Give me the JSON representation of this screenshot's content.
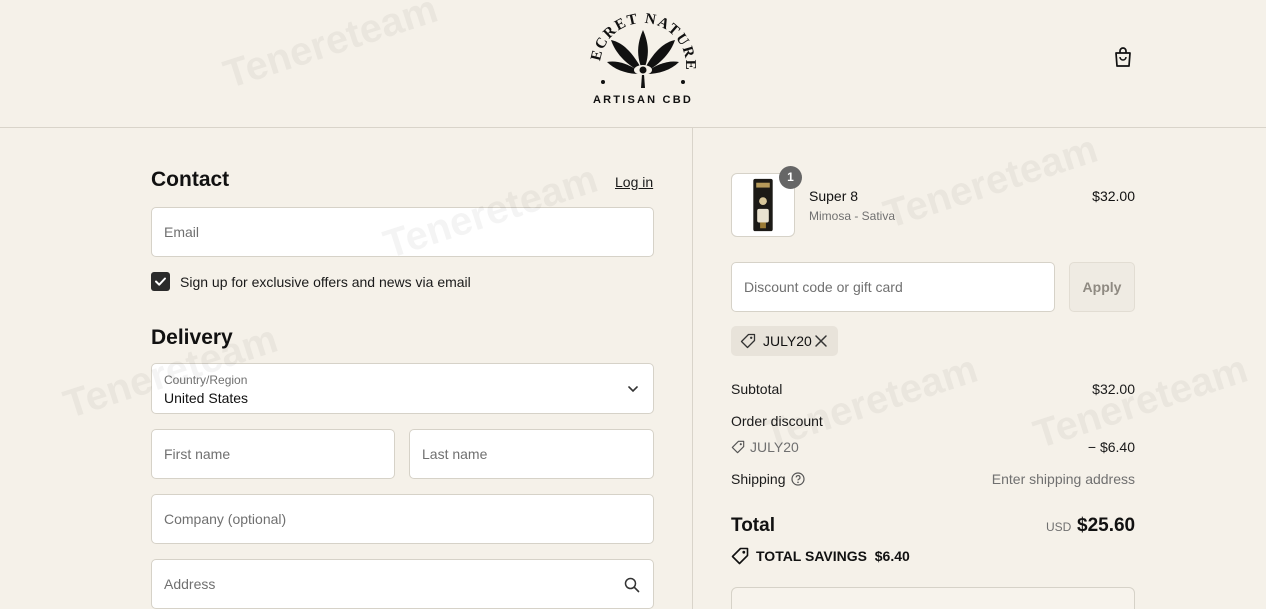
{
  "brand": {
    "name_arc": "SECRET NATURE",
    "tagline": "ARTISAN CBD"
  },
  "contact": {
    "title": "Contact",
    "login_label": "Log in",
    "email_placeholder": "Email",
    "newsletter_label": "Sign up for exclusive offers and news via email",
    "newsletter_checked": true
  },
  "delivery": {
    "title": "Delivery",
    "country_label": "Country/Region",
    "country_value": "United States",
    "first_name_placeholder": "First name",
    "last_name_placeholder": "Last name",
    "company_placeholder": "Company (optional)",
    "address_placeholder": "Address"
  },
  "order": {
    "item": {
      "name": "Super 8",
      "variant": "Mimosa - Sativa",
      "price": "$32.00",
      "quantity": "1"
    },
    "discount_placeholder": "Discount code or gift card",
    "apply_label": "Apply",
    "applied_code": "JULY20",
    "subtotal_label": "Subtotal",
    "subtotal_value": "$32.00",
    "order_discount_label": "Order discount",
    "discount_code": "JULY20",
    "discount_value": "− $6.40",
    "shipping_label": "Shipping",
    "shipping_value": "Enter shipping address",
    "total_label": "Total",
    "currency": "USD",
    "total_value": "$25.60",
    "savings_label": "TOTAL SAVINGS",
    "savings_value": "$6.40"
  },
  "watermark": "Tenereteam",
  "colors": {
    "background": "#f5f1e9",
    "checkbox": "#2b2b2b",
    "badge": "#666666"
  }
}
